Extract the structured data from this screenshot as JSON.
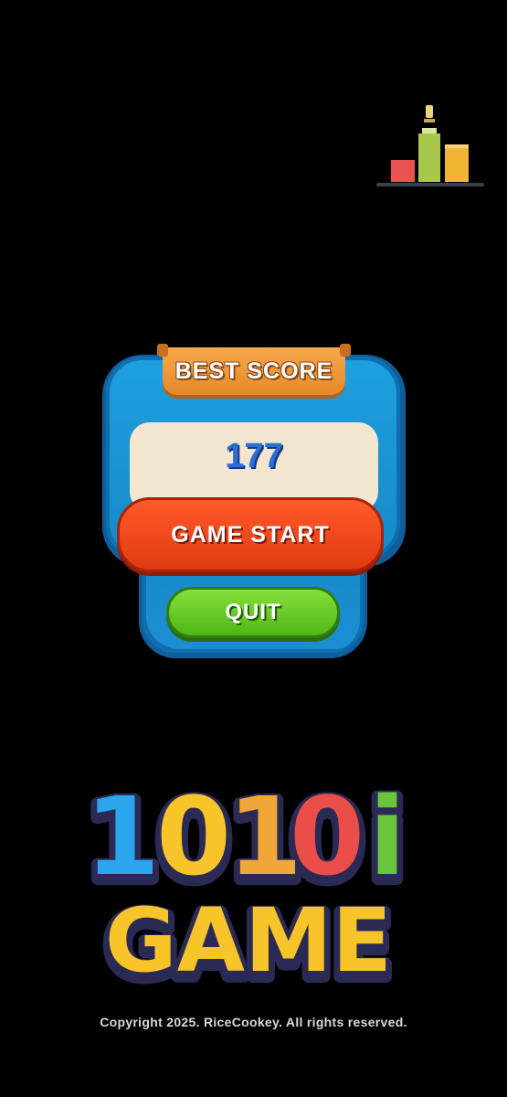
{
  "leaderboard": {
    "icon": "leaderboard-icon"
  },
  "panel": {
    "ribbon_label": "BEST SCORE",
    "best_score": "177",
    "start_label": "GAME START",
    "quit_label": "QUIT"
  },
  "logo": {
    "line1": [
      "1",
      "0",
      "1",
      "0",
      "i"
    ],
    "line2": "GAME",
    "colors": {
      "blue": "#2aa6ee",
      "yellow": "#f7c52a",
      "red": "#ea4e48",
      "green": "#6cc63d",
      "outline": "#2b2a55"
    }
  },
  "footer": {
    "copyright": "Copyright 2025. RiceCookey. All rights reserved."
  },
  "colors": {
    "background": "#000000",
    "panel_blue": "#1a8fd2",
    "start_red": "#e83d14",
    "quit_green": "#5cc41e",
    "ribbon_orange": "#ee9a3a",
    "score_blue": "#2a6fd6"
  }
}
